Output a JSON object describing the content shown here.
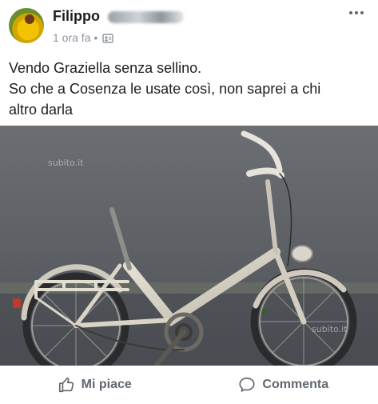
{
  "post": {
    "author": "Filippo",
    "time": "1 ora fa",
    "separator": "•",
    "text_lines": [
      "Vendo Graziella senza sellino.",
      "So che a Cosenza le usate così, non saprei a chi",
      "altro darla"
    ]
  },
  "photo": {
    "watermark_1": "subito.it",
    "watermark_2": "subito.it"
  },
  "actions": {
    "like_label": "Mi piace",
    "comment_label": "Commenta"
  },
  "icons": {
    "more": "more-options-icon",
    "privacy": "friends-privacy-icon",
    "like": "thumbs-up-icon",
    "comment": "comment-bubble-icon"
  },
  "colors": {
    "text": "#1c1e21",
    "muted": "#606770",
    "meta": "#8d949e"
  }
}
